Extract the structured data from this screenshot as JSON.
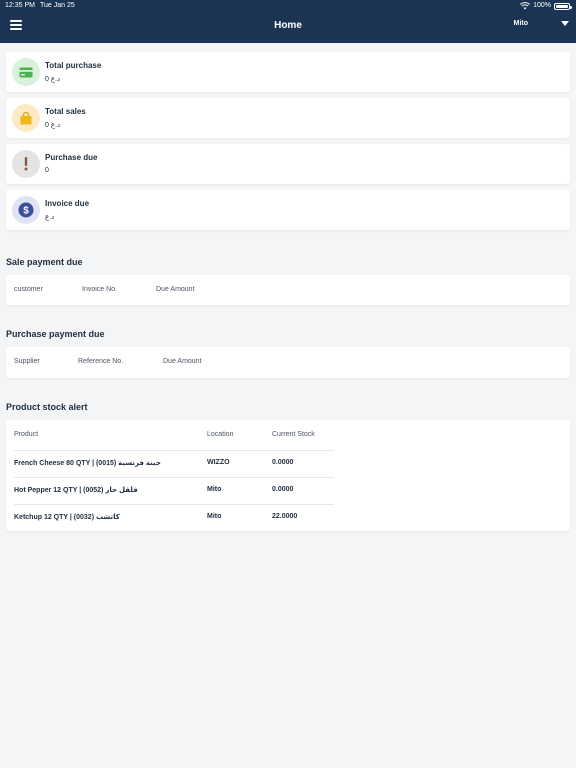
{
  "status_bar": {
    "time": "12:35 PM",
    "date": "Tue Jan 25",
    "battery": "100%"
  },
  "header": {
    "title": "Home",
    "location": "Mito"
  },
  "summary_cards": [
    {
      "label": "Total purchase",
      "value": "د.ع 0",
      "color": "#d8f0dc",
      "icon": "credit-card-icon"
    },
    {
      "label": "Total sales",
      "value": "د.ع 0",
      "color": "#fde9c6",
      "icon": "shopping-bag-icon"
    },
    {
      "label": "Purchase due",
      "value": "0",
      "color": "#e4e4e4",
      "icon": "exclamation-icon"
    },
    {
      "label": "Invoice due",
      "value": "د.ع",
      "color": "#dfe3f4",
      "icon": "dollar-icon"
    }
  ],
  "sale_payment_due": {
    "title": "Sale payment due",
    "columns": [
      "customer",
      "Invoice No.",
      "Due Amount"
    ]
  },
  "purchase_payment_due": {
    "title": "Purchase payment due",
    "columns": [
      "Supplier",
      "Reference No.",
      "Due Amount"
    ]
  },
  "stock_alert": {
    "title": "Product stock alert",
    "columns": [
      "Product",
      "Location",
      "Current Stock"
    ],
    "rows": [
      {
        "product": "French Cheese 80 QTY | (0015) جبنة فرنسية",
        "location": "WIZZO",
        "stock": "0.0000"
      },
      {
        "product": "Hot Pepper 12 QTY | (0052) فلفل حار",
        "location": "Mito",
        "stock": "0.0000"
      },
      {
        "product": "Ketchup 12 QTY | (0032) كاتشب",
        "location": "Mito",
        "stock": "22.0000"
      }
    ]
  },
  "colors": {
    "header_bg": "#1c3453",
    "page_bg": "#f4f5f7"
  }
}
